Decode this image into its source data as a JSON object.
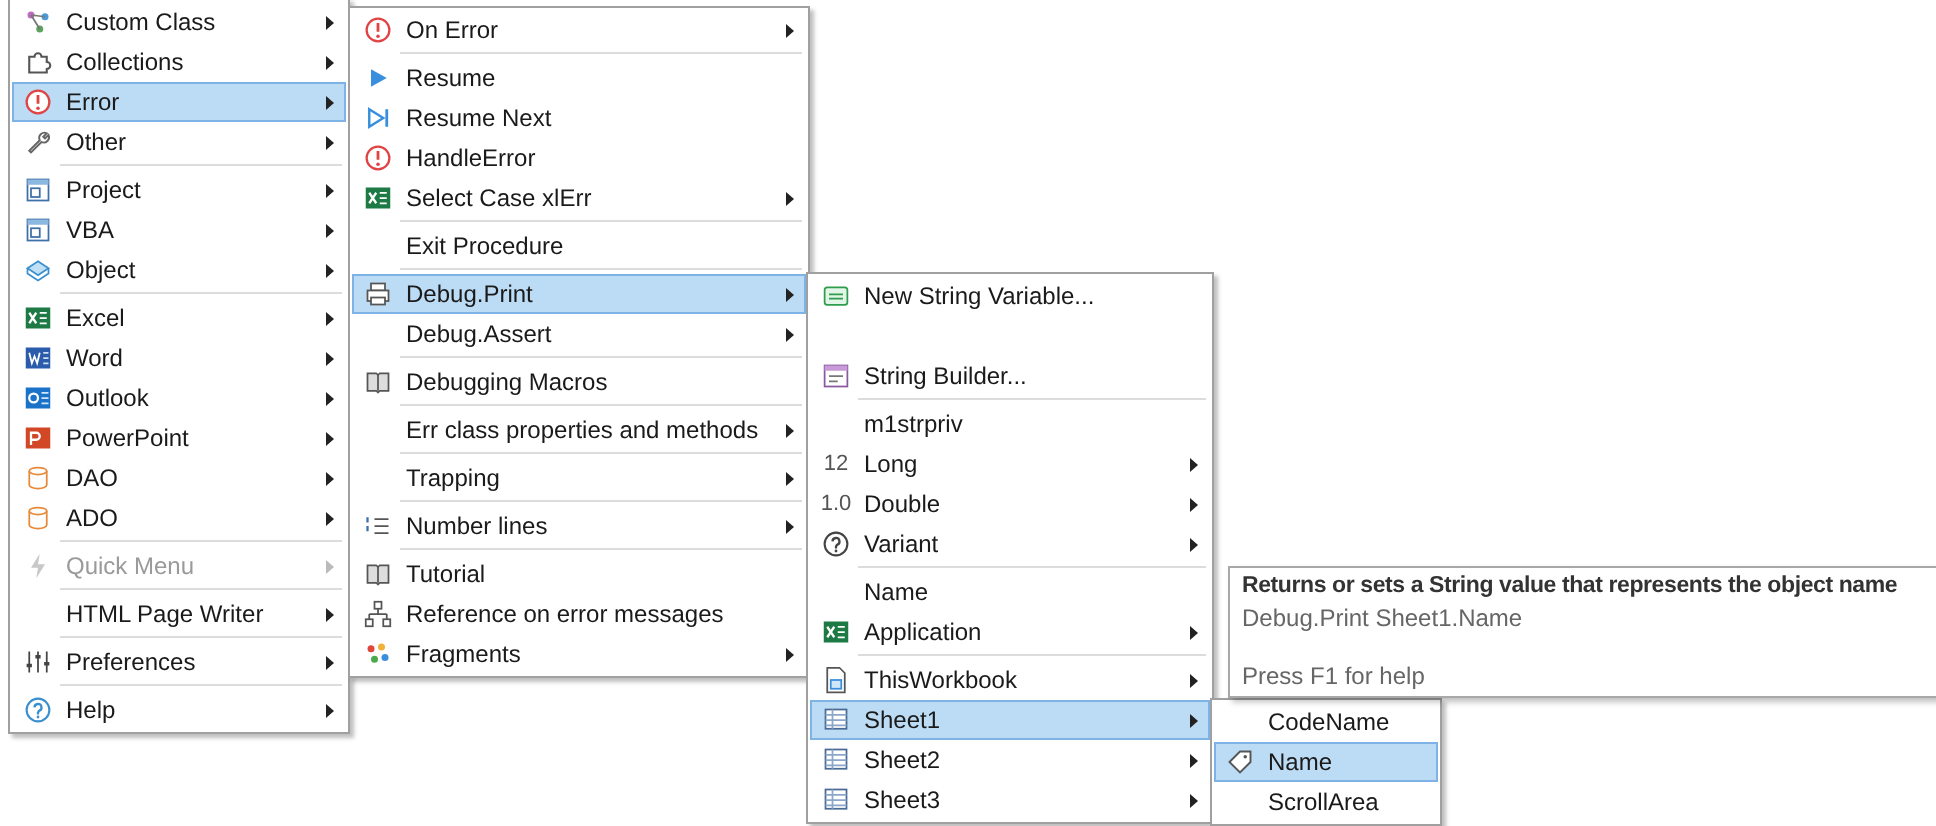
{
  "menus": [
    {
      "items": [
        {
          "label": "Custom Class",
          "kind": "class",
          "submenu": true,
          "selected": false,
          "disabled": false,
          "separator_before": false
        },
        {
          "label": "Collections",
          "kind": "collection",
          "submenu": true,
          "selected": false,
          "disabled": false,
          "separator_before": false
        },
        {
          "label": "Error",
          "kind": "error",
          "submenu": true,
          "selected": true,
          "disabled": false,
          "separator_before": false
        },
        {
          "label": "Other",
          "kind": "wrench",
          "submenu": true,
          "selected": false,
          "disabled": false,
          "separator_before": false
        },
        {
          "label": "Project",
          "kind": "window",
          "submenu": true,
          "selected": false,
          "disabled": false,
          "separator_before": true
        },
        {
          "label": "VBA",
          "kind": "window",
          "submenu": true,
          "selected": false,
          "disabled": false,
          "separator_before": false
        },
        {
          "label": "Object",
          "kind": "object",
          "submenu": true,
          "selected": false,
          "disabled": false,
          "separator_before": false
        },
        {
          "label": "Excel",
          "kind": "excel",
          "submenu": true,
          "selected": false,
          "disabled": false,
          "separator_before": true
        },
        {
          "label": "Word",
          "kind": "word",
          "submenu": true,
          "selected": false,
          "disabled": false,
          "separator_before": false
        },
        {
          "label": "Outlook",
          "kind": "outlook",
          "submenu": true,
          "selected": false,
          "disabled": false,
          "separator_before": false
        },
        {
          "label": "PowerPoint",
          "kind": "powerpoint",
          "submenu": true,
          "selected": false,
          "disabled": false,
          "separator_before": false
        },
        {
          "label": "DAO",
          "kind": "database",
          "submenu": true,
          "selected": false,
          "disabled": false,
          "separator_before": false
        },
        {
          "label": "ADO",
          "kind": "database",
          "submenu": true,
          "selected": false,
          "disabled": false,
          "separator_before": false
        },
        {
          "label": "Quick Menu",
          "kind": "lightning",
          "submenu": true,
          "selected": false,
          "disabled": true,
          "separator_before": true
        },
        {
          "label": "HTML Page Writer",
          "kind": "plain",
          "submenu": true,
          "selected": false,
          "disabled": false,
          "separator_before": true
        },
        {
          "label": "Preferences",
          "kind": "sliders",
          "submenu": true,
          "selected": false,
          "disabled": false,
          "separator_before": true
        },
        {
          "label": "Help",
          "kind": "help",
          "submenu": true,
          "selected": false,
          "disabled": false,
          "separator_before": true
        }
      ]
    },
    {
      "items": [
        {
          "label": "On Error",
          "kind": "error",
          "submenu": true,
          "selected": false,
          "separator_before": false
        },
        {
          "label": "Resume",
          "kind": "play",
          "submenu": false,
          "selected": false,
          "separator_before": true
        },
        {
          "label": "Resume Next",
          "kind": "skip",
          "submenu": false,
          "selected": false,
          "separator_before": false
        },
        {
          "label": "HandleError",
          "kind": "error",
          "submenu": false,
          "selected": false,
          "separator_before": false
        },
        {
          "label": "Select Case xlErr",
          "kind": "excel",
          "submenu": true,
          "selected": false,
          "separator_before": false
        },
        {
          "label": "Exit Procedure",
          "kind": "plain",
          "submenu": false,
          "selected": false,
          "separator_before": true
        },
        {
          "label": "Debug.Print",
          "kind": "printer",
          "submenu": true,
          "selected": true,
          "separator_before": true
        },
        {
          "label": "Debug.Assert",
          "kind": "plain",
          "submenu": true,
          "selected": false,
          "separator_before": false
        },
        {
          "label": "Debugging Macros",
          "kind": "book",
          "submenu": false,
          "selected": false,
          "separator_before": true
        },
        {
          "label": "Err class properties and methods",
          "kind": "plain",
          "submenu": true,
          "selected": false,
          "separator_before": true
        },
        {
          "label": "Trapping",
          "kind": "plain",
          "submenu": true,
          "selected": false,
          "separator_before": true
        },
        {
          "label": "Number lines",
          "kind": "numbered",
          "submenu": true,
          "selected": false,
          "separator_before": true
        },
        {
          "label": "Tutorial",
          "kind": "book",
          "submenu": false,
          "selected": false,
          "separator_before": true
        },
        {
          "label": "Reference on error messages",
          "kind": "hierarchy",
          "submenu": false,
          "selected": false,
          "separator_before": false
        },
        {
          "label": "Fragments",
          "kind": "fragments",
          "submenu": true,
          "selected": false,
          "separator_before": false
        }
      ]
    },
    {
      "items": [
        {
          "label": "New String Variable...",
          "kind": "textbox",
          "submenu": false,
          "selected": false,
          "separator_before": false
        },
        {
          "kind": "blank"
        },
        {
          "label": "String Builder...",
          "kind": "builder",
          "submenu": false,
          "selected": false,
          "separator_before": false
        },
        {
          "label": "m1strpriv",
          "kind": "plain",
          "submenu": false,
          "selected": false,
          "separator_before": true
        },
        {
          "label": "Long",
          "kind": "glyph",
          "glyph": "12",
          "submenu": true,
          "selected": false,
          "separator_before": false
        },
        {
          "label": "Double",
          "kind": "glyph",
          "glyph": "1.0",
          "submenu": true,
          "selected": false,
          "separator_before": false
        },
        {
          "label": "Variant",
          "kind": "question",
          "submenu": true,
          "selected": false,
          "separator_before": false
        },
        {
          "label": "Name",
          "kind": "plain",
          "submenu": false,
          "selected": false,
          "separator_before": true
        },
        {
          "label": "Application",
          "kind": "excel",
          "submenu": true,
          "selected": false,
          "separator_before": false
        },
        {
          "label": "ThisWorkbook",
          "kind": "workbook",
          "submenu": true,
          "selected": false,
          "separator_before": true
        },
        {
          "label": "Sheet1",
          "kind": "sheet",
          "submenu": true,
          "selected": true,
          "separator_before": false
        },
        {
          "label": "Sheet2",
          "kind": "sheet",
          "submenu": true,
          "selected": false,
          "separator_before": false
        },
        {
          "label": "Sheet3",
          "kind": "sheet",
          "submenu": true,
          "selected": false,
          "separator_before": false
        }
      ]
    },
    {
      "items": [
        {
          "label": "CodeName",
          "kind": "plain",
          "submenu": false,
          "selected": false,
          "separator_before": false
        },
        {
          "label": "Name",
          "kind": "tag",
          "submenu": false,
          "selected": true,
          "separator_before": false
        },
        {
          "label": "ScrollArea",
          "kind": "plain",
          "submenu": false,
          "selected": false,
          "separator_before": false
        }
      ]
    }
  ],
  "tooltip": {
    "title": "Returns or sets a String value that represents the object name",
    "syntax": "Debug.Print Sheet1.Name",
    "hint": "Press F1 for help"
  }
}
